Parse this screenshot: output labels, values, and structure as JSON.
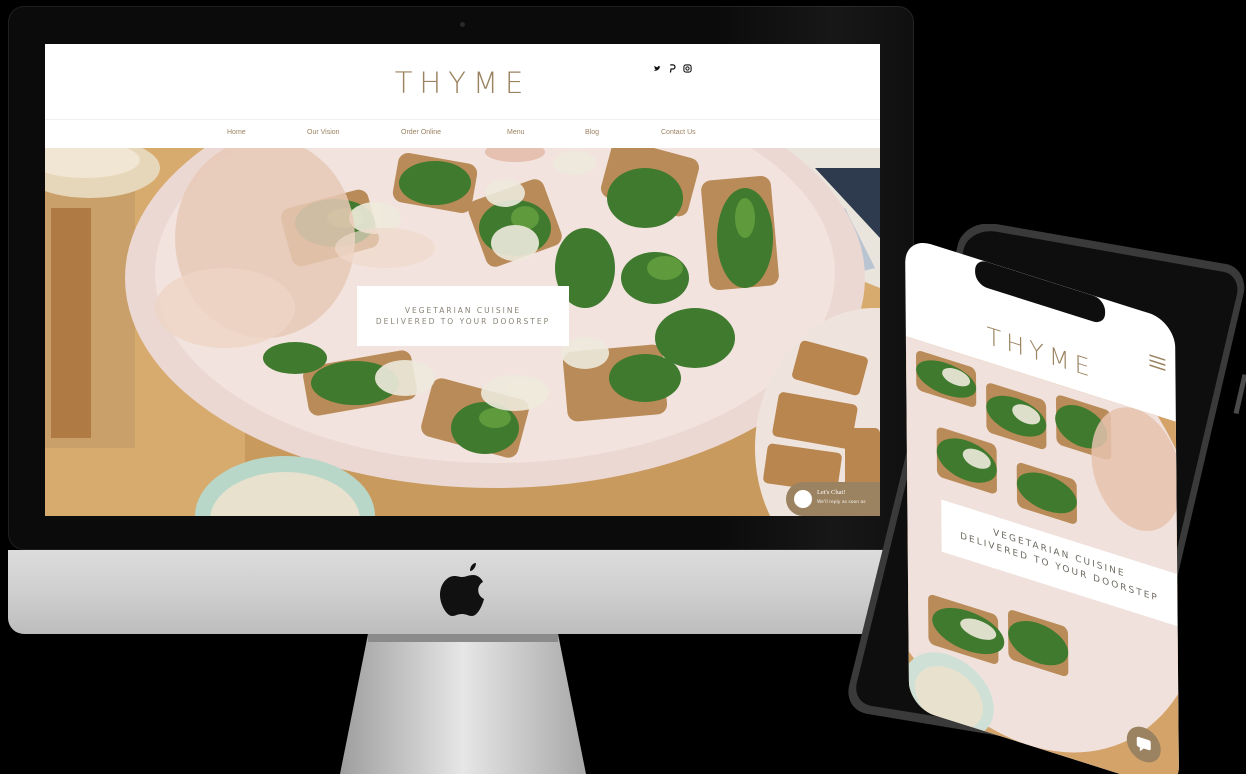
{
  "desktop_site": {
    "logo": "THYME",
    "social_icons": [
      "twitter-icon",
      "pinterest-icon",
      "instagram-icon"
    ],
    "nav": [
      {
        "label": "Home"
      },
      {
        "label": "Our Vision"
      },
      {
        "label": "Order Online"
      },
      {
        "label": "Menu"
      },
      {
        "label": "Blog"
      },
      {
        "label": "Contact Us"
      }
    ],
    "hero_caption_line1": "VEGETARIAN CUISINE",
    "hero_caption_line2": "DELIVERED TO YOUR DOORSTEP",
    "chat": {
      "title": "Let's Chat!",
      "subtitle": "We'll reply as soon as"
    }
  },
  "mobile_site": {
    "logo": "THYME",
    "menu_icon": "hamburger-menu-icon",
    "hero_caption_line1": "VEGETARIAN CUISINE",
    "hero_caption_line2": "DELIVERED TO YOUR DOORSTEP",
    "chat_icon": "chat-icon"
  },
  "colors": {
    "brand_gold": "#9b8260",
    "background": "#000000",
    "site_background": "#ffffff",
    "imac_silver": "#cfcfcf"
  }
}
